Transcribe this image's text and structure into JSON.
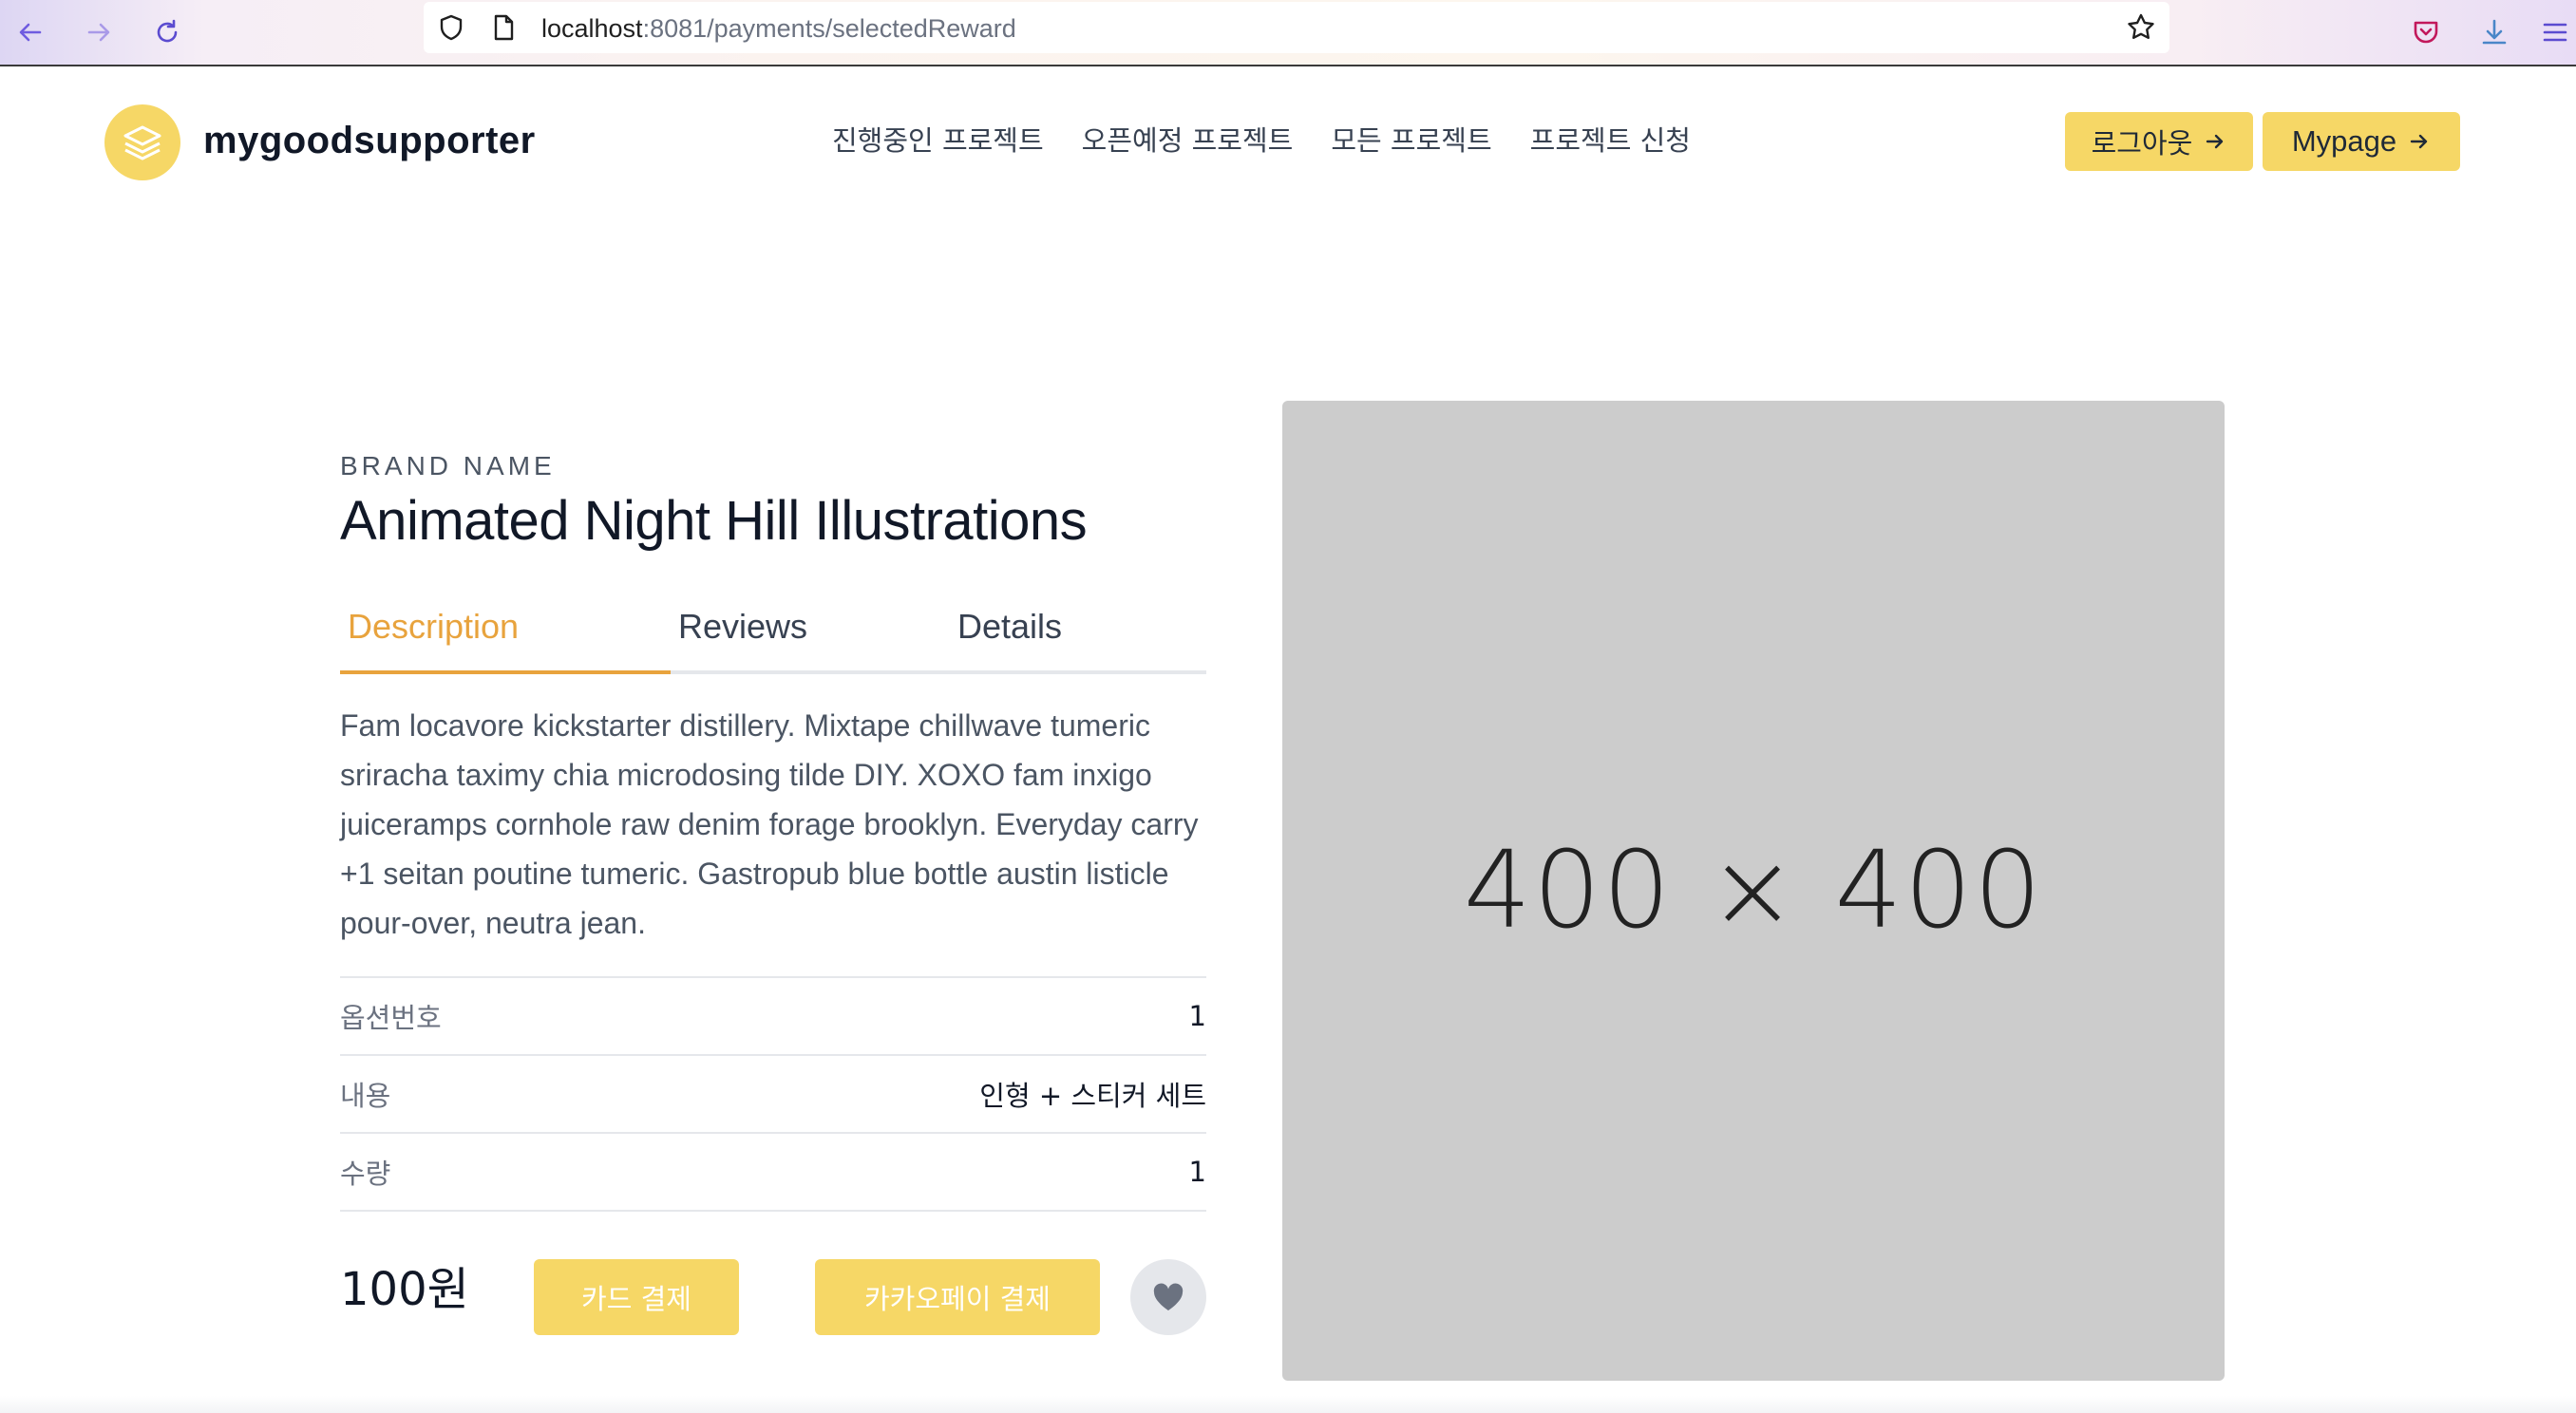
{
  "browser": {
    "url_host": "localhost",
    "url_path": ":8081/payments/selectedReward",
    "icons": [
      "back-arrow-icon",
      "forward-arrow-icon",
      "reload-icon",
      "shield-icon",
      "page-icon",
      "star-icon",
      "pocket-icon",
      "download-icon",
      "menu-icon"
    ]
  },
  "header": {
    "brand": "mygoodsupporter",
    "nav": [
      "진행중인 프로젝트",
      "오픈예정 프로젝트",
      "모든 프로젝트",
      "프로젝트 신청"
    ],
    "logout_label": "로그아웃",
    "mypage_label": "Mypage"
  },
  "product": {
    "brand_name": "BRAND NAME",
    "title": "Animated Night Hill Illustrations",
    "tabs": [
      "Description",
      "Reviews",
      "Details"
    ],
    "active_tab": "Description",
    "description": "Fam locavore kickstarter distillery. Mixtape chillwave tumeric sriracha taximy chia microdosing tilde DIY. XOXO fam inxigo juiceramps cornhole raw denim forage brooklyn. Everyday carry +1 seitan poutine tumeric. Gastropub blue bottle austin listicle pour-over, neutra jean.",
    "info": [
      {
        "label": "옵션번호",
        "value": "1"
      },
      {
        "label": "내용",
        "value": "인형 + 스티커 세트"
      },
      {
        "label": "수량",
        "value": "1"
      }
    ],
    "price": "100원",
    "card_pay_label": "카드 결제",
    "kakao_pay_label": "카카오페이 결제",
    "image_placeholder": "400 × 400"
  },
  "colors": {
    "accent": "#f6d766",
    "active_tab": "#e8a33d",
    "placeholder_bg": "#cccccc"
  }
}
